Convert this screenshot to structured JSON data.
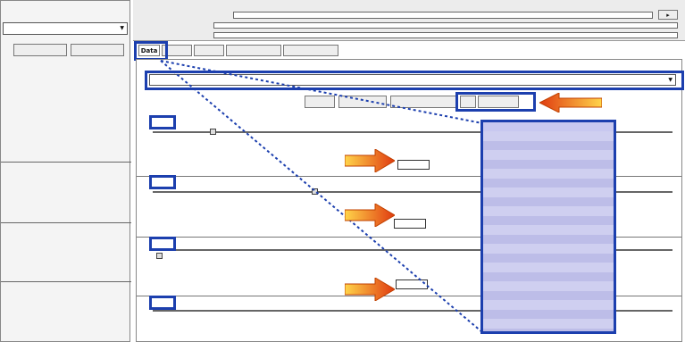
{
  "colors": {
    "highlight": "#1c3fae",
    "list_bg": "#c8c8f0",
    "arrow": "#f0a000"
  },
  "left_panel": {
    "header": "",
    "dropdown_value": "",
    "btn1": "",
    "btn2": "",
    "section_label": "",
    "radio1": "",
    "radio2": "",
    "radio3": "",
    "value1": "",
    "sec2": "",
    "value2": "",
    "sec3": "",
    "value3": "",
    "sec4": "",
    "value4": ""
  },
  "top_bar": {
    "row1_label": "",
    "row2_label": "",
    "row3_label": ""
  },
  "tabs": [
    {
      "label": "Data"
    },
    {
      "label": ""
    },
    {
      "label": ""
    },
    {
      "label": ""
    },
    {
      "label": ""
    }
  ],
  "main": {
    "sub_title": "",
    "path_value": "",
    "toolbar_buttons": [
      "",
      "",
      "",
      "",
      ""
    ],
    "var_labels": [
      "",
      "",
      "",
      ""
    ],
    "row_left_vals": [
      "",
      "",
      ""
    ],
    "row_right_vals": [
      "",
      "",
      ""
    ],
    "bottom_labels": [
      "",
      ""
    ]
  },
  "list": {
    "header": "",
    "values": [
      "",
      "",
      "",
      "",
      "",
      "",
      "",
      "",
      "",
      "",
      "",
      "",
      "",
      "",
      "",
      "",
      "",
      "",
      "",
      "",
      "",
      ""
    ]
  },
  "icons": {
    "arrow": "right-arrow-icon",
    "dropdown": "chevron-down-icon"
  }
}
